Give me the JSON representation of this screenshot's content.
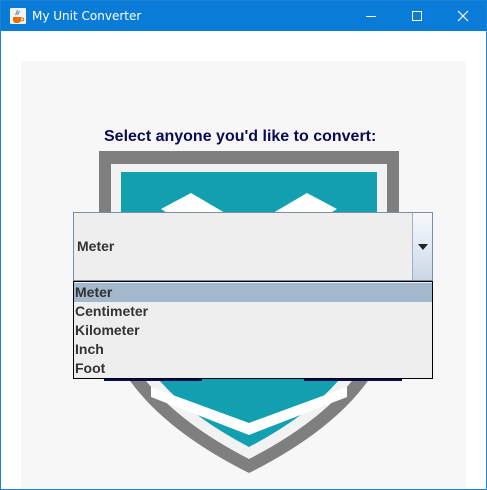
{
  "window": {
    "title": "My Unit Converter",
    "icon": "java-cup-icon",
    "accent_color": "#0a7bd6"
  },
  "controls": {
    "minimize": "minimize-icon",
    "maximize": "maximize-icon",
    "close": "close-icon"
  },
  "main": {
    "prompt": "Select anyone you'd like to convert:",
    "prompt_color": "#0b0b54",
    "unit_select": {
      "selected": "Meter",
      "options": [
        "Meter",
        "Centimeter",
        "Kilometer",
        "Inch",
        "Foot"
      ],
      "highlighted_index": 0,
      "highlight_color": "#a3b8cc"
    },
    "logo": {
      "icon": "shield-logo",
      "colors": {
        "outer": "#7f7f7f",
        "inner": "#12a0b0",
        "check": "#ffffff"
      }
    }
  }
}
